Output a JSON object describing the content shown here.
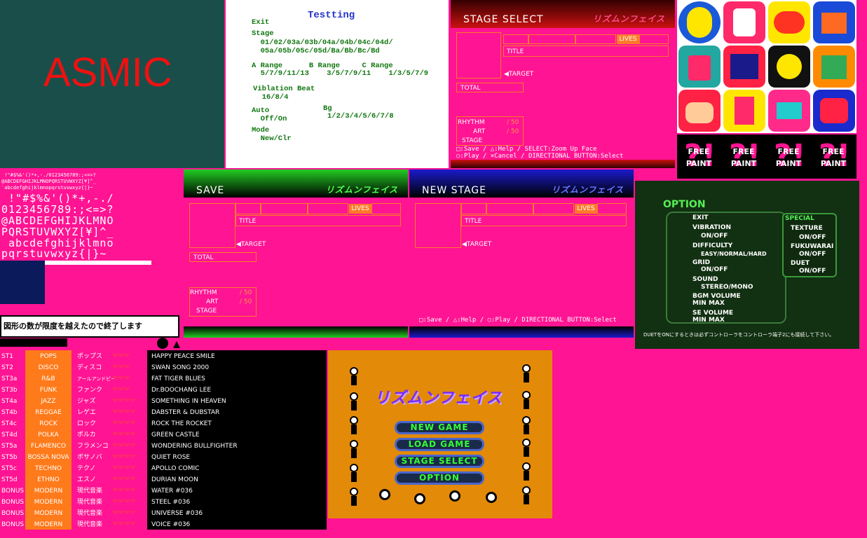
{
  "asmic": {
    "text": "ASMIC"
  },
  "test": {
    "title": "Testting",
    "lines": [
      "Exit",
      "Stage",
      "  01/02/03a/03b/04a/04b/04c/04d/",
      "  05a/05b/05c/05d/Ba/Bb/Bc/Bd",
      "A Range      B Range     C Range",
      "  5/7/9/11/13    3/5/7/9/11    1/3/5/7/9",
      "Viblation Beat",
      "  16/8/4",
      "Auto",
      "  Off/On",
      "Mode",
      "  New/Clr"
    ],
    "bg_label": "Bg",
    "bg_values": "1/2/3/4/5/6/7/8"
  },
  "stage_select": {
    "title": "STAGE SELECT",
    "logo": "リズムンフェイス",
    "lives": "LIVES",
    "title_label": "TITLE",
    "target": "◀TARGET",
    "total": "TOTAL",
    "rhythm": "RHYTHM",
    "art": "ART",
    "stage": "STAGE",
    "rhythm_val": "/ 50",
    "art_val": "/ 50",
    "help1": "□:Save / △:Help / SELECT:Zoom Up Face",
    "help2": "○:Play / ×Cancel / DIRECTIONAL BUTTON:Select"
  },
  "save": {
    "title": "SAVE",
    "logo": "リズムンフェイス",
    "lives": "LIVES",
    "title_label": "TITLE",
    "target": "◀TARGET",
    "total": "TOTAL",
    "rhythm": "RHYTHM",
    "art": "ART",
    "stage": "STAGE",
    "rhythm_val": "/ 50",
    "art_val": "/ 50"
  },
  "new_stage": {
    "title": "NEW STAGE",
    "logo": "リズムンフェイス",
    "lives": "LIVES",
    "title_label": "TITLE",
    "target": "◀TARGET",
    "help": "□:Save / △:Help / ○:Play / DIRECTIONAL BUTTON:Select"
  },
  "free_paint": {
    "label1": "FREE",
    "label2": "PAINT"
  },
  "font_rows": [
    " !\"#$%&'()*+,-./0123456789:;<=>?",
    "@ABCDEFGHIJKLMNOPQRSTUVWXYZ[¥]^_",
    "`abcdefghijklmnopqrstuvwxyz{|}~",
    " !\"#$%&'()*+,-./",
    "0123456789:;<=>?",
    "@ABCDEFGHIJKLMNO",
    "PQRSTUVWXYZ[¥]^_",
    " abcdefghijklmno",
    "pqrstuvwxyz{|}~"
  ],
  "warning": "図形の数が限度を越えたので終了します",
  "option": {
    "title": "OPTION",
    "items": [
      {
        "label": "EXIT",
        "value": ""
      },
      {
        "label": "VIBRATION",
        "value": "ON/OFF"
      },
      {
        "label": "DIFFICULTY",
        "value": "EASY/NORMAL/HARD"
      },
      {
        "label": "GRID",
        "value": "ON/OFF"
      },
      {
        "label": "SOUND",
        "value": "STEREO/MONO"
      },
      {
        "label": "BGM VOLUME",
        "value": "MIN                    MAX"
      },
      {
        "label": "SE VOLUME",
        "value": "MIN                    MAX"
      }
    ],
    "special": "SPECIAL",
    "special_items": [
      {
        "label": "TEXTURE",
        "value": "ON/OFF"
      },
      {
        "label": "FUKUWARAI",
        "value": "ON/OFF"
      },
      {
        "label": "DUET",
        "value": "ON/OFF"
      }
    ],
    "note": "DUETをONにするときは必ずコントローラをコントローラ端子2にも接続して下さい。"
  },
  "stages": [
    {
      "id": "ST1",
      "genre": "POPS",
      "jp": "ポップス",
      "hearts": "❤❤❤",
      "title": "HAPPY PEACE SMILE"
    },
    {
      "id": "ST2",
      "genre": "DISCO",
      "jp": "ディスコ",
      "hearts": "❤❤❤",
      "title": "SWAN SONG 2000"
    },
    {
      "id": "ST3a",
      "genre": "R&B",
      "jp": "アールアンドビー",
      "hearts": "❤❤❤",
      "title": "FAT TIGER BLUES"
    },
    {
      "id": "ST3b",
      "genre": "FUNK",
      "jp": "ファンク",
      "hearts": "❤❤❤",
      "title": "Dr.BOOCHANG LEE"
    },
    {
      "id": "ST4a",
      "genre": "JAZZ",
      "jp": "ジャズ",
      "hearts": "❤❤❤❤",
      "title": "SOMETHING IN HEAVEN"
    },
    {
      "id": "ST4b",
      "genre": "REGGAE",
      "jp": "レゲエ",
      "hearts": "❤❤❤❤",
      "title": "DABSTER & DUBSTAR"
    },
    {
      "id": "ST4c",
      "genre": "ROCK",
      "jp": "ロック",
      "hearts": "❤❤❤❤",
      "title": "ROCK THE ROCKET"
    },
    {
      "id": "ST4d",
      "genre": "POLKA",
      "jp": "ポルカ",
      "hearts": "❤❤❤❤",
      "title": "GREEN CASTLE"
    },
    {
      "id": "ST5a",
      "genre": "FLAMENCO",
      "jp": "フラメンコ",
      "hearts": "❤❤❤❤",
      "title": "WONDERING BULLFIGHTER"
    },
    {
      "id": "ST5b",
      "genre": "BOSSA NOVA",
      "jp": "ボサノバ",
      "hearts": "❤❤❤❤",
      "title": "QUIET ROSE"
    },
    {
      "id": "ST5c",
      "genre": "TECHNO",
      "jp": "テクノ",
      "hearts": "❤❤❤❤",
      "title": "APOLLO COMIC"
    },
    {
      "id": "ST5d",
      "genre": "ETHNO",
      "jp": "エスノ",
      "hearts": "❤❤❤❤",
      "title": "DURIAN MOON"
    },
    {
      "id": "BONUS",
      "genre": "MODERN",
      "jp": "現代音楽",
      "hearts": "❤❤❤❤",
      "title": "WATER #036"
    },
    {
      "id": "BONUS",
      "genre": "MODERN",
      "jp": "現代音楽",
      "hearts": "❤❤❤❤",
      "title": "STEEL #036"
    },
    {
      "id": "BONUS",
      "genre": "MODERN",
      "jp": "現代音楽",
      "hearts": "❤❤❤❤",
      "title": "UNIVERSE #036"
    },
    {
      "id": "BONUS",
      "genre": "MODERN",
      "jp": "現代音楽",
      "hearts": "❤❤❤❤",
      "title": "VOICE #036"
    }
  ],
  "menu": {
    "logo": "リズムンフェイス",
    "items": [
      "NEW GAME",
      "LOAD GAME",
      "STAGE SELECT",
      "OPTION"
    ]
  },
  "colors": {
    "magenta": "#ff1493",
    "orange": "#ff7a2a",
    "green_bar": "#22aa22",
    "blue_bar": "#1a1aaa",
    "menu_bg": "#e38a08"
  }
}
